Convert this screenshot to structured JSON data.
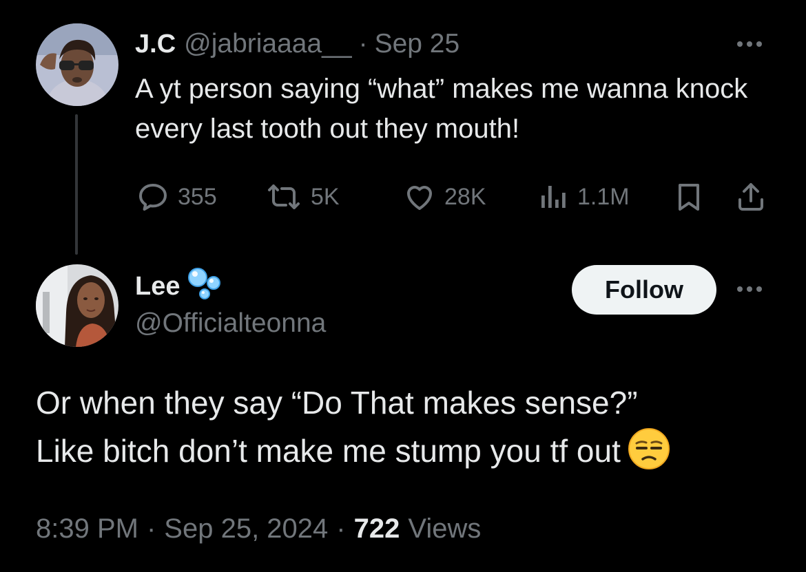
{
  "original_tweet": {
    "author_name": "J.C",
    "handle": "@jabriaaaa__",
    "separator": "·",
    "date": "Sep 25",
    "text": "A yt person saying “what” makes me wanna knock every last tooth out they mouth!",
    "icons": {
      "reply": "reply-icon",
      "retweet": "retweet-icon",
      "like": "heart-icon",
      "views": "views-icon",
      "bookmark": "bookmark-icon",
      "share": "share-icon",
      "more": "more-icon"
    },
    "stats": {
      "replies": "355",
      "retweets": "5K",
      "likes": "28K",
      "views": "1.1M"
    }
  },
  "reply_tweet": {
    "author_name": "Lee",
    "name_emoji": "bubbles-icon",
    "handle": "@Officialteonna",
    "follow_label": "Follow",
    "text_line1": "Or when they say “Do That makes sense?”",
    "text_line2": "Like bitch don’t make me stump you tf out",
    "emoji": "unamused-face-emoji",
    "time": "8:39 PM",
    "separator": "·",
    "date": "Sep 25, 2024",
    "views_count": "722",
    "views_label": "Views"
  },
  "colors": {
    "background": "#000000",
    "primary_text": "#e7e9ea",
    "secondary_text": "#71767b",
    "thread_line": "#333639",
    "follow_button_bg": "#eff3f4",
    "follow_button_text": "#0f1419"
  }
}
